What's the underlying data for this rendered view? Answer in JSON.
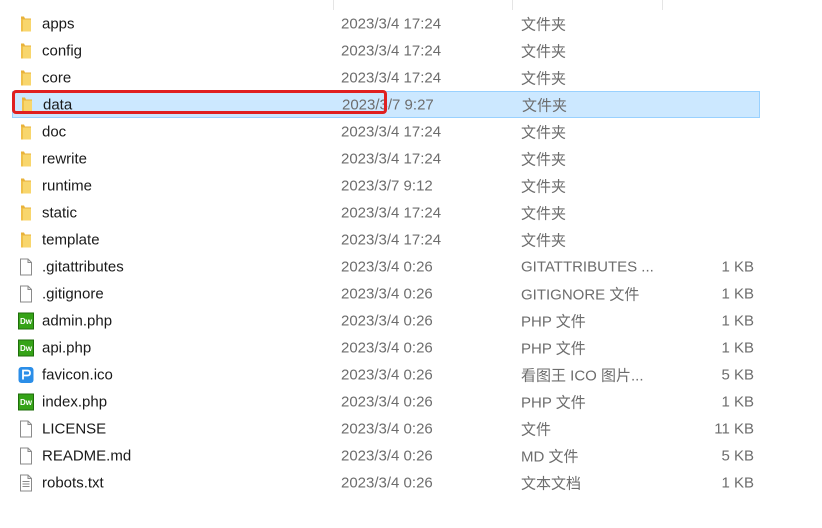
{
  "files": [
    {
      "name": "apps",
      "date": "2023/3/4 17:24",
      "type": "文件夹",
      "size": "",
      "icon": "folder-icon"
    },
    {
      "name": "config",
      "date": "2023/3/4 17:24",
      "type": "文件夹",
      "size": "",
      "icon": "folder-icon"
    },
    {
      "name": "core",
      "date": "2023/3/4 17:24",
      "type": "文件夹",
      "size": "",
      "icon": "folder-icon"
    },
    {
      "name": "data",
      "date": "2023/3/7 9:27",
      "type": "文件夹",
      "size": "",
      "icon": "folder-icon",
      "selected": true
    },
    {
      "name": "doc",
      "date": "2023/3/4 17:24",
      "type": "文件夹",
      "size": "",
      "icon": "folder-icon"
    },
    {
      "name": "rewrite",
      "date": "2023/3/4 17:24",
      "type": "文件夹",
      "size": "",
      "icon": "folder-icon"
    },
    {
      "name": "runtime",
      "date": "2023/3/7 9:12",
      "type": "文件夹",
      "size": "",
      "icon": "folder-icon"
    },
    {
      "name": "static",
      "date": "2023/3/4 17:24",
      "type": "文件夹",
      "size": "",
      "icon": "folder-icon"
    },
    {
      "name": "template",
      "date": "2023/3/4 17:24",
      "type": "文件夹",
      "size": "",
      "icon": "folder-icon"
    },
    {
      "name": ".gitattributes",
      "date": "2023/3/4 0:26",
      "type": "GITATTRIBUTES ...",
      "size": "1 KB",
      "icon": "file-icon"
    },
    {
      "name": ".gitignore",
      "date": "2023/3/4 0:26",
      "type": "GITIGNORE 文件",
      "size": "1 KB",
      "icon": "file-icon"
    },
    {
      "name": "admin.php",
      "date": "2023/3/4 0:26",
      "type": "PHP 文件",
      "size": "1 KB",
      "icon": "dreamweaver-icon"
    },
    {
      "name": "api.php",
      "date": "2023/3/4 0:26",
      "type": "PHP 文件",
      "size": "1 KB",
      "icon": "dreamweaver-icon"
    },
    {
      "name": "favicon.ico",
      "date": "2023/3/4 0:26",
      "type": "看图王 ICO 图片...",
      "size": "5 KB",
      "icon": "image-viewer-icon"
    },
    {
      "name": "index.php",
      "date": "2023/3/4 0:26",
      "type": "PHP 文件",
      "size": "1 KB",
      "icon": "dreamweaver-icon"
    },
    {
      "name": "LICENSE",
      "date": "2023/3/4 0:26",
      "type": "文件",
      "size": "11 KB",
      "icon": "file-icon"
    },
    {
      "name": "README.md",
      "date": "2023/3/4 0:26",
      "type": "MD 文件",
      "size": "5 KB",
      "icon": "file-icon"
    },
    {
      "name": "robots.txt",
      "date": "2023/3/4 0:26",
      "type": "文本文档",
      "size": "1 KB",
      "icon": "text-file-icon"
    }
  ],
  "colors": {
    "selection_bg": "#cce8ff",
    "selection_border": "#99d1ff",
    "highlight_box": "#e02020",
    "folder": "#f8c94a",
    "dreamweaver": "#35a317"
  }
}
